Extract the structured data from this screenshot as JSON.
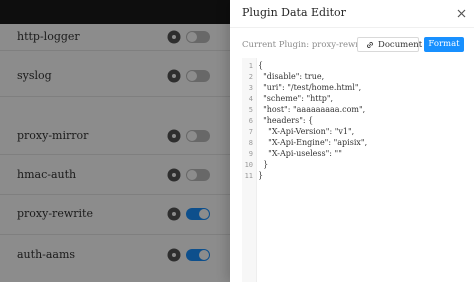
{
  "plugins": [
    {
      "name": "http-logger",
      "enabled": false
    },
    {
      "name": "syslog",
      "enabled": false
    },
    {
      "name": "proxy-mirror",
      "enabled": false
    },
    {
      "name": "hmac-auth",
      "enabled": false
    },
    {
      "name": "proxy-rewrite",
      "enabled": true
    },
    {
      "name": "auth-aams",
      "enabled": true
    }
  ],
  "drawer": {
    "title": "Plugin Data Editor",
    "current_plugin_label": "Current Plugin: proxy-rewrite",
    "document_button": "Document",
    "format_button": "Format"
  },
  "editor": {
    "line_numbers": [
      "1",
      "2",
      "3",
      "4",
      "5",
      "6",
      "7",
      "8",
      "9",
      "10",
      "11"
    ],
    "lines": [
      "{",
      "  \"disable\": true,",
      "  \"uri\": \"/test/home.html\",",
      "  \"scheme\": \"http\",",
      "  \"host\": \"aaaaaaaaa.com\",",
      "  \"headers\": {",
      "    \"X-Api-Version\": \"v1\",",
      "    \"X-Api-Engine\": \"apisix\",",
      "    \"X-Api-useless\": \"\"",
      "  }",
      "}"
    ]
  },
  "colors": {
    "accent": "#1890ff",
    "overlay": "rgba(0,0,0,0.45)",
    "topbar": "#1a1a1a"
  }
}
